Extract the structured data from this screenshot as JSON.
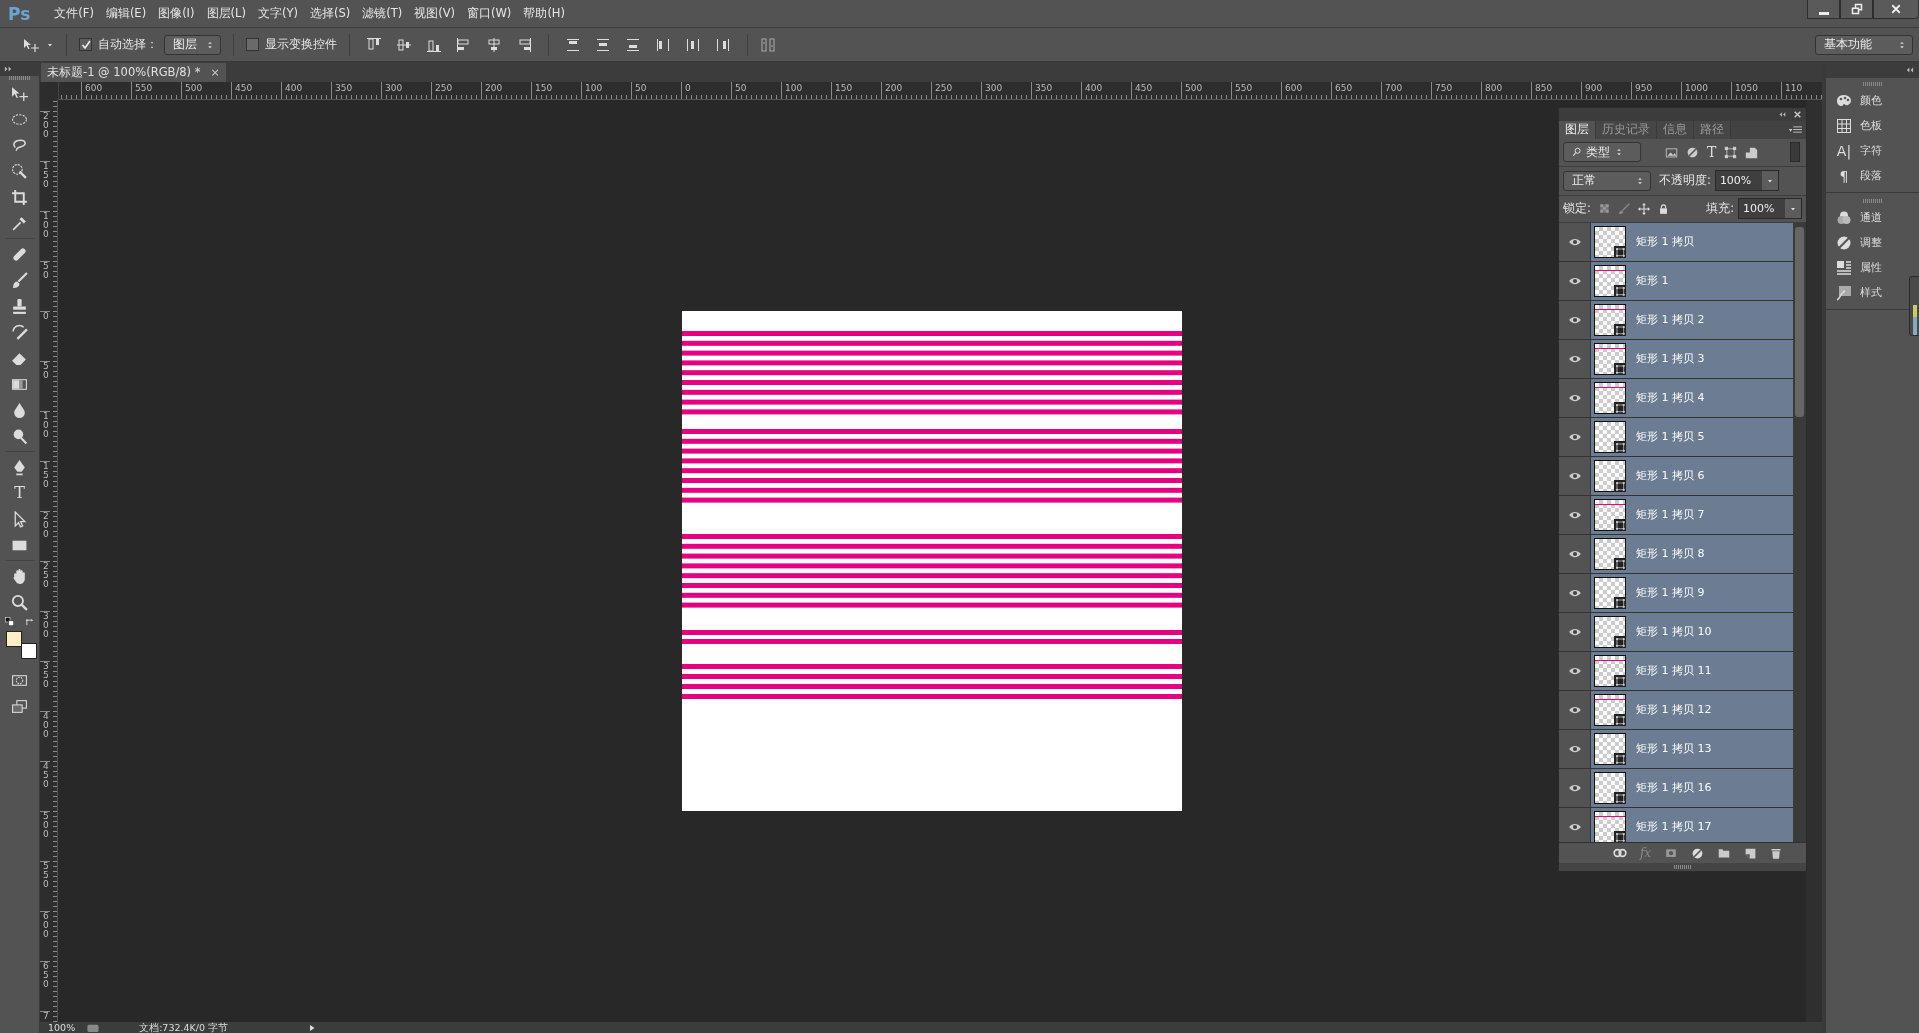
{
  "app": {
    "logo": "Ps"
  },
  "menu": [
    "文件(F)",
    "编辑(E)",
    "图像(I)",
    "图层(L)",
    "文字(Y)",
    "选择(S)",
    "滤镜(T)",
    "视图(V)",
    "窗口(W)",
    "帮助(H)"
  ],
  "options_bar": {
    "auto_select": {
      "label": "自动选择：",
      "checked": true
    },
    "auto_select_target": "图层",
    "transform_controls": {
      "label": "显示变换控件",
      "checked": false
    },
    "workspace": "基本功能"
  },
  "document_tab": {
    "title": "未标题-1 @ 100%(RGB/8) *",
    "close": "×",
    "selected": true
  },
  "rulers": {
    "horizontal": [
      "600",
      "550",
      "500",
      "450",
      "400",
      "350",
      "300",
      "250",
      "200",
      "150",
      "100",
      "50",
      "0",
      "50",
      "100",
      "150",
      "200",
      "250",
      "300",
      "350",
      "400",
      "450",
      "500",
      "550",
      "600",
      "650",
      "700",
      "750",
      "800",
      "850",
      "900",
      "950",
      "1000",
      "1050",
      "110"
    ],
    "vertical": [
      "200",
      "150",
      "100",
      "50",
      "0",
      "50",
      "100",
      "150",
      "200",
      "250",
      "300",
      "350",
      "400",
      "450",
      "500",
      "550",
      "600",
      "650",
      "7"
    ]
  },
  "tools": {
    "type_tool": "T",
    "swatches": [
      {
        "kind": "foreground",
        "color": "#fcefc6"
      },
      {
        "kind": "background",
        "color": "#ffffff"
      }
    ]
  },
  "layers_panel": {
    "tabs": [
      {
        "label": "图层",
        "selected": true
      },
      {
        "label": "历史记录",
        "selected": false
      },
      {
        "label": "信息",
        "selected": false
      },
      {
        "label": "路径",
        "selected": false
      }
    ],
    "filter": "类型",
    "filter_type_glyph": "T",
    "blend_mode": "正常",
    "opacity_label": "不透明度:",
    "opacity": "100%",
    "lock_label": "锁定:",
    "fill_label": "填充:",
    "fill": "100%",
    "fx_button": "fx",
    "layers": [
      {
        "name": "矩形 1 拷贝",
        "visible": true,
        "selected": true,
        "thumbnail_stripe": false
      },
      {
        "name": "矩形 1",
        "visible": true,
        "selected": true,
        "thumbnail_stripe": true
      },
      {
        "name": "矩形 1 拷贝 2",
        "visible": true,
        "selected": true,
        "thumbnail_stripe": true
      },
      {
        "name": "矩形 1 拷贝 3",
        "visible": true,
        "selected": true,
        "thumbnail_stripe": true
      },
      {
        "name": "矩形 1 拷贝 4",
        "visible": true,
        "selected": true,
        "thumbnail_stripe": true
      },
      {
        "name": "矩形 1 拷贝 5",
        "visible": true,
        "selected": true,
        "thumbnail_stripe": false
      },
      {
        "name": "矩形 1 拷贝 6",
        "visible": true,
        "selected": true,
        "thumbnail_stripe": false
      },
      {
        "name": "矩形 1 拷贝 7",
        "visible": true,
        "selected": true,
        "thumbnail_stripe": true
      },
      {
        "name": "矩形 1 拷贝 8",
        "visible": true,
        "selected": true,
        "thumbnail_stripe": false
      },
      {
        "name": "矩形 1 拷贝 9",
        "visible": true,
        "selected": true,
        "thumbnail_stripe": false
      },
      {
        "name": "矩形 1 拷贝 10",
        "visible": true,
        "selected": true,
        "thumbnail_stripe": false
      },
      {
        "name": "矩形 1 拷贝 11",
        "visible": true,
        "selected": true,
        "thumbnail_stripe": true
      },
      {
        "name": "矩形 1 拷贝 12",
        "visible": true,
        "selected": true,
        "thumbnail_stripe": true
      },
      {
        "name": "矩形 1 拷贝 13",
        "visible": true,
        "selected": true,
        "thumbnail_stripe": false
      },
      {
        "name": "矩形 1 拷贝 16",
        "visible": true,
        "selected": true,
        "thumbnail_stripe": false
      },
      {
        "name": "矩形 1 拷贝 17",
        "visible": true,
        "selected": true,
        "thumbnail_stripe": true
      }
    ]
  },
  "dock": [
    [
      {
        "label": "颜色"
      },
      {
        "label": "色板"
      },
      {
        "label": "字符",
        "glyph": "A|"
      },
      {
        "label": "段落",
        "glyph": "¶"
      }
    ],
    [
      {
        "label": "通道"
      },
      {
        "label": "调整"
      },
      {
        "label": "属性"
      },
      {
        "label": "样式"
      }
    ]
  ],
  "status_bar": {
    "zoom": "100%",
    "info": "文档:732.4K/0 字节"
  }
}
